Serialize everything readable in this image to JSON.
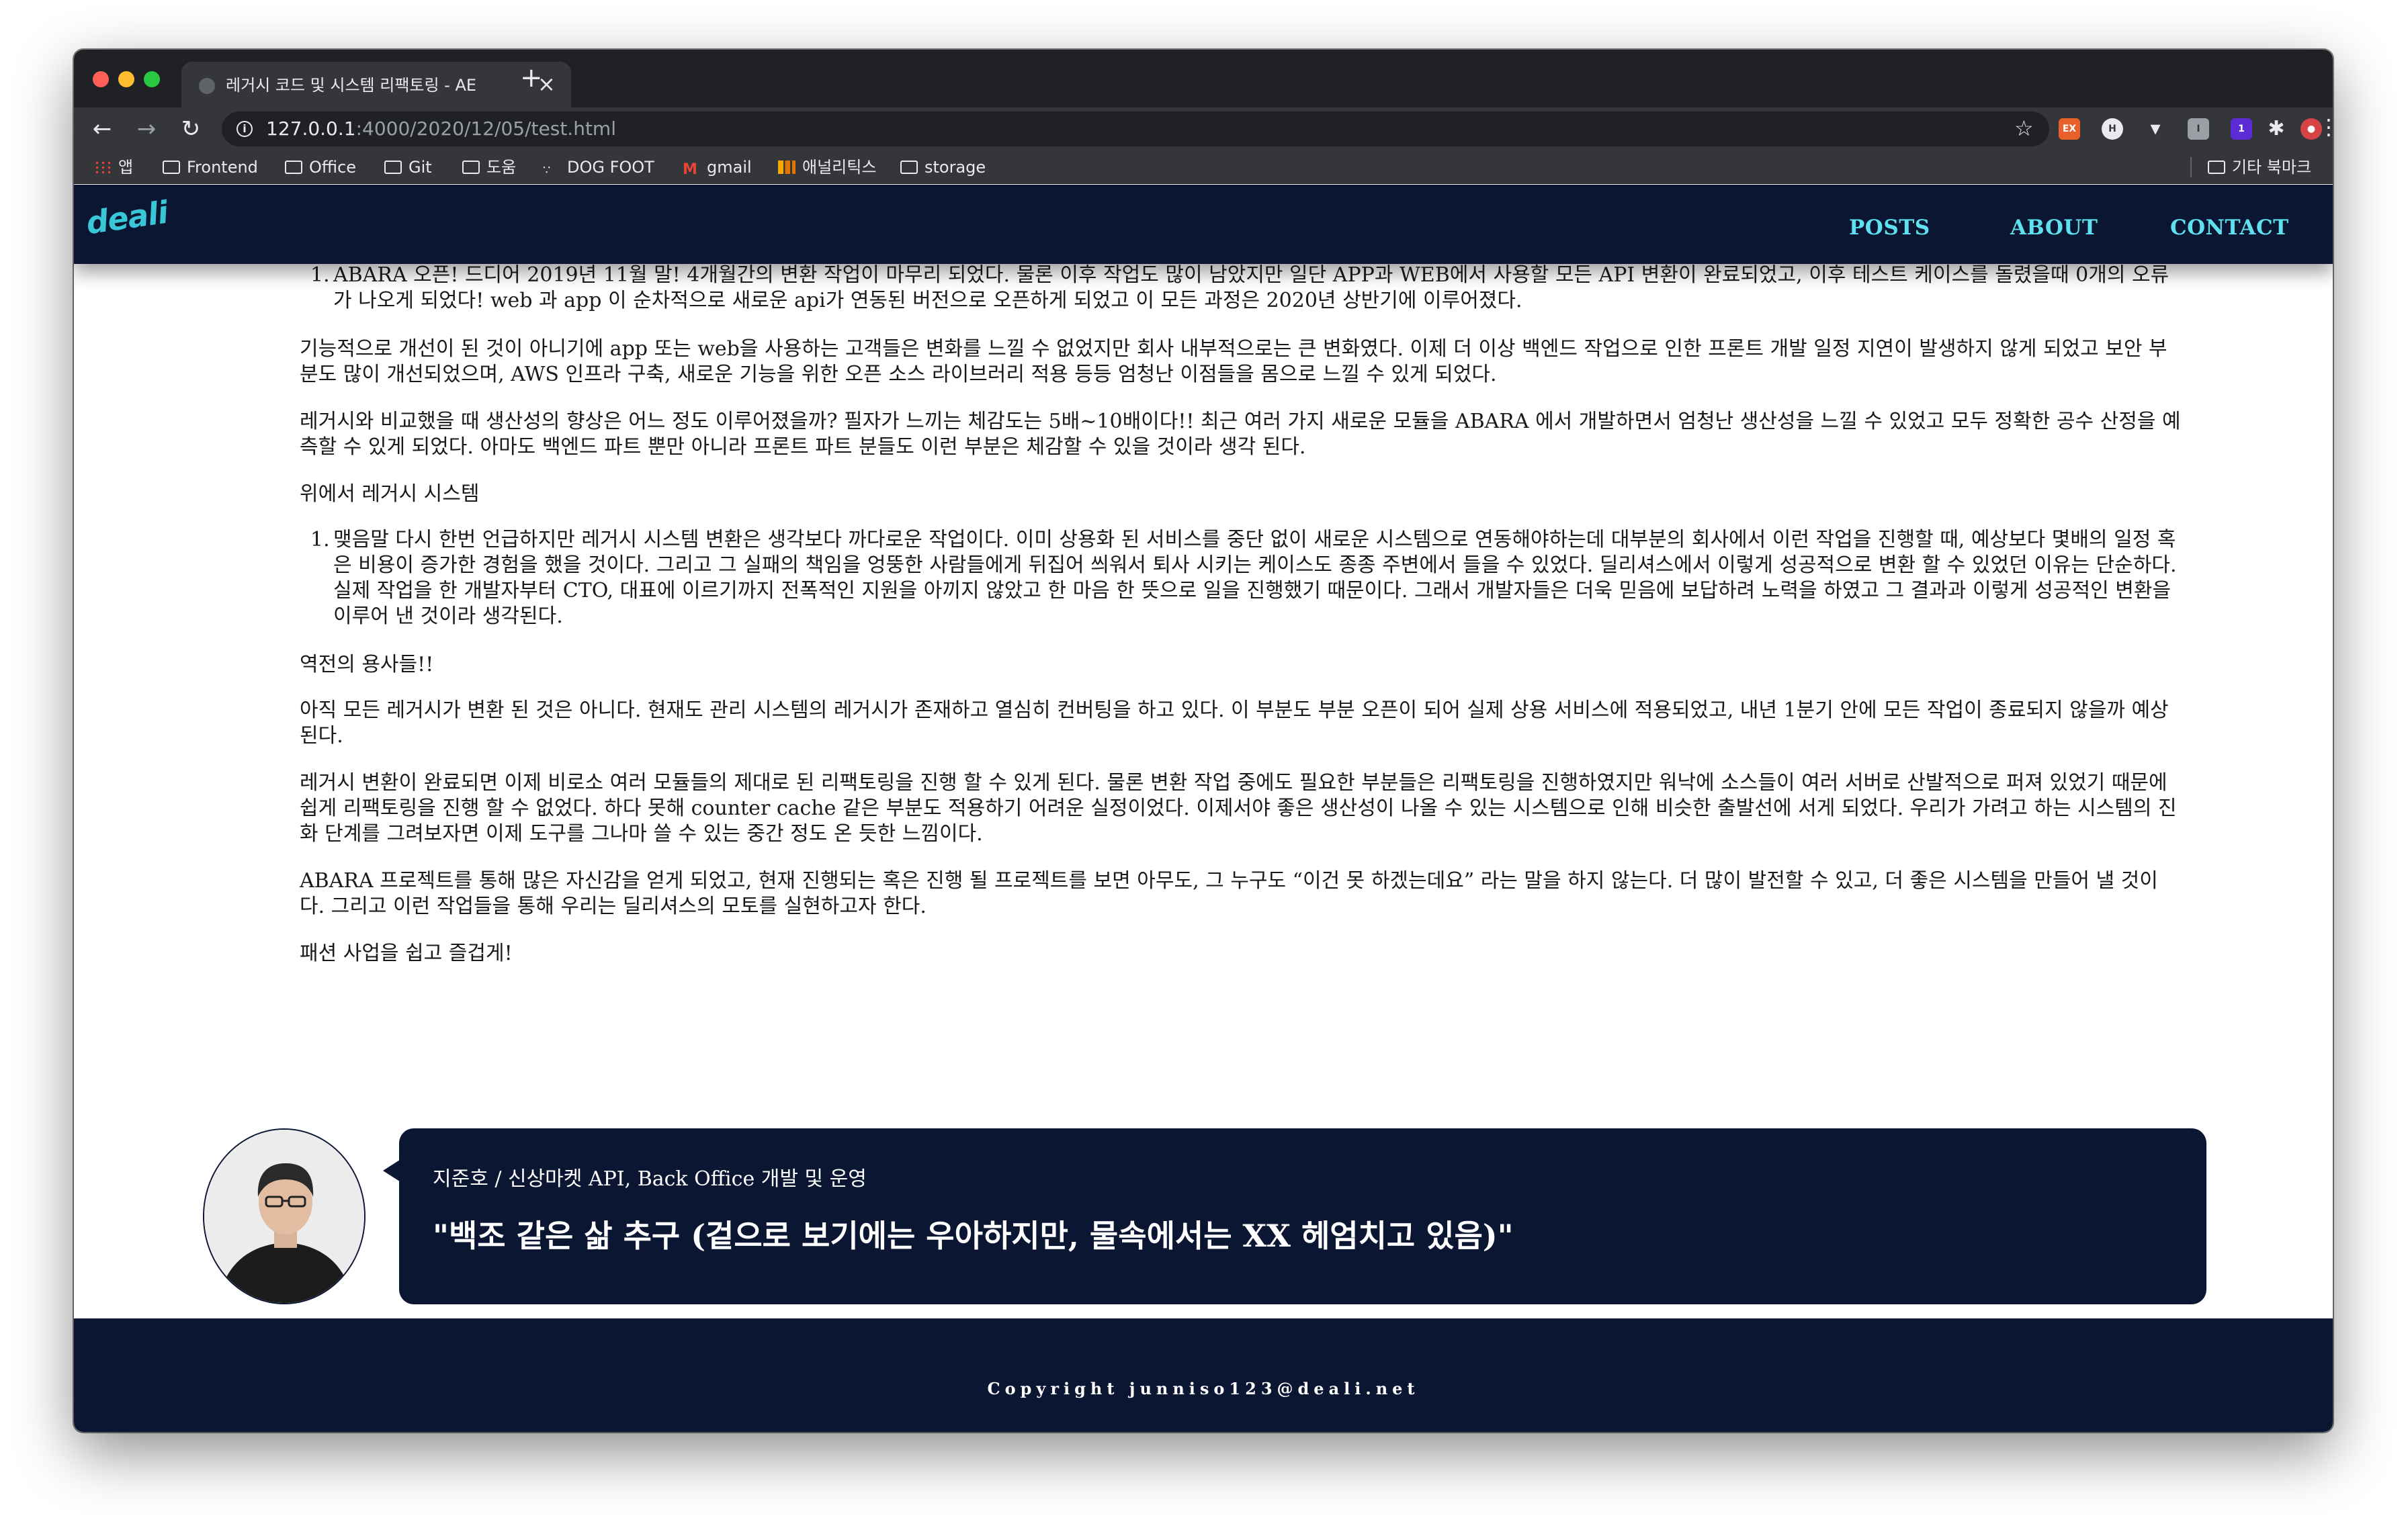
{
  "browser": {
    "tab_title": "레거시 코드 및 시스템 리팩토링 - AE",
    "url_host": "127.0.0.1",
    "url_path": ":4000/2020/12/05/test.html",
    "bookmarks": [
      "앱",
      "Frontend",
      "Office",
      "Git",
      "도움",
      "DOG FOOT",
      "gmail",
      "애널리틱스",
      "storage"
    ],
    "other_bookmarks": "기타 북마크"
  },
  "site": {
    "logo": "deali",
    "nav": [
      "POSTS",
      "ABOUT",
      "CONTACT"
    ]
  },
  "article": {
    "list1_item": "ABARA 오픈! 드디어 2019년 11월 말! 4개월간의 변환 작업이 마무리 되었다. 물론 이후 작업도 많이 남았지만 일단 APP과 WEB에서 사용할 모든 API 변환이 완료되었고, 이후 테스트 케이스를 돌렸을때 0개의 오류가 나오게 되었다! web 과 app 이 순차적으로 새로운 api가 연동된 버전으로 오픈하게 되었고 이 모든 과정은 2020년 상반기에 이루어졌다.",
    "p1": "기능적으로 개선이 된 것이 아니기에 app 또는 web을 사용하는 고객들은 변화를 느낄 수 없었지만 회사 내부적으로는 큰 변화였다. 이제 더 이상 백엔드 작업으로 인한 프론트 개발 일정 지연이 발생하지 않게 되었고 보안 부분도 많이 개선되었으며, AWS 인프라 구축, 새로운 기능을 위한 오픈 소스 라이브러리 적용 등등 엄청난 이점들을 몸으로 느낄 수 있게 되었다.",
    "p2": "레거시와 비교했을 때 생산성의 향상은 어느 정도 이루어졌을까? 필자가 느끼는 체감도는 5배~10배이다!! 최근 여러 가지 새로운 모듈을 ABARA 에서 개발하면서 엄청난 생산성을 느낄 수 있었고 모두 정확한 공수 산정을 예측할 수 있게 되었다. 아마도 백엔드 파트 뿐만 아니라 프론트 파트 분들도 이런 부분은 체감할 수 있을 것이라 생각 된다.",
    "p3": "위에서 레거시 시스템",
    "list2_item": "맺음말 다시 한번 언급하지만 레거시 시스템 변환은 생각보다 까다로운 작업이다. 이미 상용화 된 서비스를 중단 없이 새로운 시스템으로 연동해야하는데 대부분의 회사에서 이런 작업을 진행할 때, 예상보다 몇배의 일정 혹은 비용이 증가한 경험을 했을 것이다. 그리고 그 실패의 책임을 엉뚱한 사람들에게 뒤집어 씌워서 퇴사 시키는 케이스도 종종 주변에서 들을 수 있었다. 딜리셔스에서 이렇게 성공적으로 변환 할 수 있었던 이유는 단순하다. 실제 작업을 한 개발자부터 CTO, 대표에 이르기까지 전폭적인 지원을 아끼지 않았고 한 마음 한 뜻으로 일을 진행했기 때문이다. 그래서 개발자들은 더욱 믿음에 보답하려 노력을 하였고 그 결과과 이렇게 성공적인 변환을 이루어 낸 것이라 생각된다.",
    "p4": "역전의 용사들!!",
    "p5": "아직 모든 레거시가 변환 된 것은 아니다. 현재도 관리 시스템의 레거시가 존재하고 열심히 컨버팅을 하고 있다. 이 부분도 부분 오픈이 되어 실제 상용 서비스에 적용되었고, 내년 1분기 안에 모든 작업이 종료되지 않을까 예상된다.",
    "p6": "레거시 변환이 완료되면 이제 비로소 여러 모듈들의 제대로 된 리팩토링을 진행 할 수 있게 된다. 물론 변환 작업 중에도 필요한 부분들은 리팩토링을 진행하였지만 워낙에 소스들이 여러 서버로 산발적으로 퍼져 있었기 때문에 쉽게 리팩토링을 진행 할 수 없었다. 하다 못해 counter cache 같은 부분도 적용하기 어려운 실정이었다. 이제서야 좋은 생산성이 나올 수 있는 시스템으로 인해 비슷한 출발선에 서게 되었다. 우리가 가려고 하는 시스템의 진화 단계를 그려보자면 이제 도구를 그나마 쓸 수 있는 중간 정도 온 듯한 느낌이다.",
    "p7": "ABARA 프로젝트를 통해 많은 자신감을 얻게 되었고, 현재 진행되는 혹은 진행 될 프로젝트를 보면 아무도, 그 누구도 “이건 못 하겠는데요” 라는 말을 하지 않는다. 더 많이 발전할 수 있고, 더 좋은 시스템을 만들어 낼 것이다. 그리고 이런 작업들을 통해 우리는 딜리셔스의 모토를 실현하고자 한다.",
    "p8": "패션 사업을 쉽고 즐겁게!"
  },
  "author": {
    "role": "지준호 / 신상마켓 API, Back Office 개발 및 운영",
    "quote": "\"백조 같은 삶 추구 (겉으로 보기에는 우아하지만, 물속에서는 XX 헤엄치고 있음)\""
  },
  "footer": {
    "copyright": "Copyright junniso123@deali.net"
  },
  "colors": {
    "navy": "#0b1633",
    "accent": "#5fe0ee"
  }
}
